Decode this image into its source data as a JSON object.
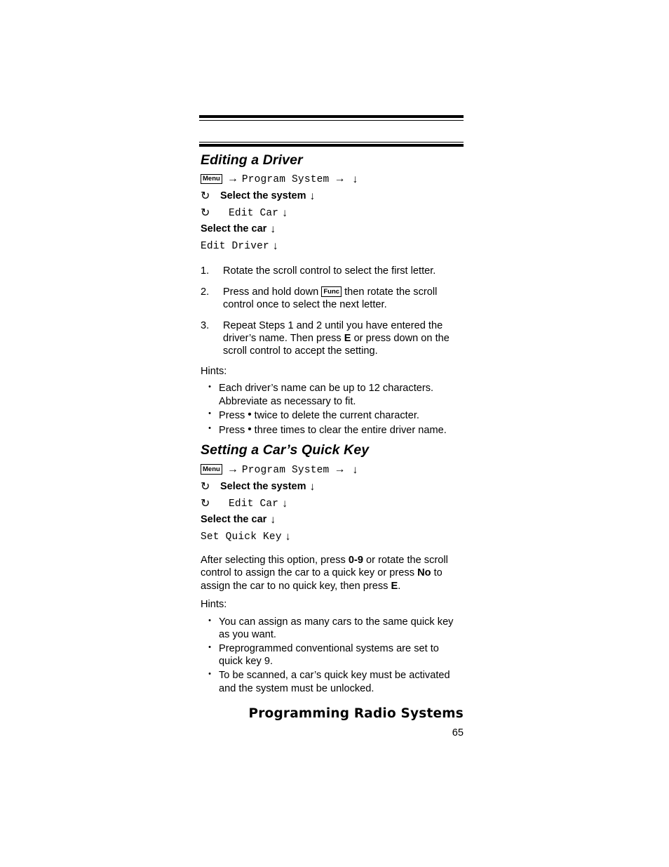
{
  "document": {
    "footer_title": "Programming Radio Systems",
    "page_number": "65"
  },
  "icons": {
    "rotate": "↻",
    "arrow_right": "→",
    "arrow_down": "↓",
    "bullet": "•",
    "key_dot": "•"
  },
  "sections": [
    {
      "heading": "Editing a Driver",
      "nav": {
        "menu_key": "Menu",
        "line1_item": "Program System",
        "line2_text": "Select the system",
        "line3_item": "Edit Car",
        "line4_text": "Select the car",
        "line5_item": "Edit Driver"
      },
      "steps": [
        {
          "num": "1.",
          "parts": [
            {
              "t": "text",
              "v": "Rotate the scroll control to select the first letter."
            }
          ]
        },
        {
          "num": "2.",
          "parts": [
            {
              "t": "text",
              "v": "Press and hold down "
            },
            {
              "t": "badge",
              "v": "Func"
            },
            {
              "t": "text",
              "v": " then rotate the scroll control once to select the next letter."
            }
          ]
        },
        {
          "num": "3.",
          "parts": [
            {
              "t": "text",
              "v": "Repeat Steps 1 and 2 until you have entered the driver’s name. Then press "
            },
            {
              "t": "bold",
              "v": "E"
            },
            {
              "t": "text",
              "v": " or press down on the scroll control to accept the setting."
            }
          ]
        }
      ],
      "hints_label": "Hints:",
      "hints": [
        [
          {
            "t": "text",
            "v": "Each driver’s name can be up to 12 characters. Abbreviate as necessary to fit."
          }
        ],
        [
          {
            "t": "text",
            "v": "Press "
          },
          {
            "t": "keydot",
            "v": "•"
          },
          {
            "t": "text",
            "v": " twice to delete the current character."
          }
        ],
        [
          {
            "t": "text",
            "v": "Press "
          },
          {
            "t": "keydot",
            "v": "•"
          },
          {
            "t": "text",
            "v": " three times to clear the entire driver name."
          }
        ]
      ]
    },
    {
      "heading": "Setting a Car’s Quick Key",
      "nav": {
        "menu_key": "Menu",
        "line1_item": "Program System",
        "line2_text": "Select the system",
        "line3_item": "Edit Car",
        "line4_text": "Select the car",
        "line5_item": "Set Quick Key"
      },
      "paragraph": [
        {
          "t": "text",
          "v": "After selecting this option, press "
        },
        {
          "t": "bold",
          "v": "0-9"
        },
        {
          "t": "text",
          "v": " or rotate the scroll control to assign the car to a quick key or press "
        },
        {
          "t": "bold",
          "v": "No"
        },
        {
          "t": "text",
          "v": " to assign the car to no quick key, then press "
        },
        {
          "t": "bold",
          "v": "E"
        },
        {
          "t": "text",
          "v": "."
        }
      ],
      "hints_label": "Hints:",
      "hints": [
        [
          {
            "t": "text",
            "v": "You can assign as many cars to the same quick key as you want."
          }
        ],
        [
          {
            "t": "text",
            "v": "Preprogrammed conventional systems are set to quick key 9."
          }
        ],
        [
          {
            "t": "text",
            "v": "To be scanned, a car’s quick key must be activated and the system must be unlocked."
          }
        ]
      ]
    }
  ]
}
